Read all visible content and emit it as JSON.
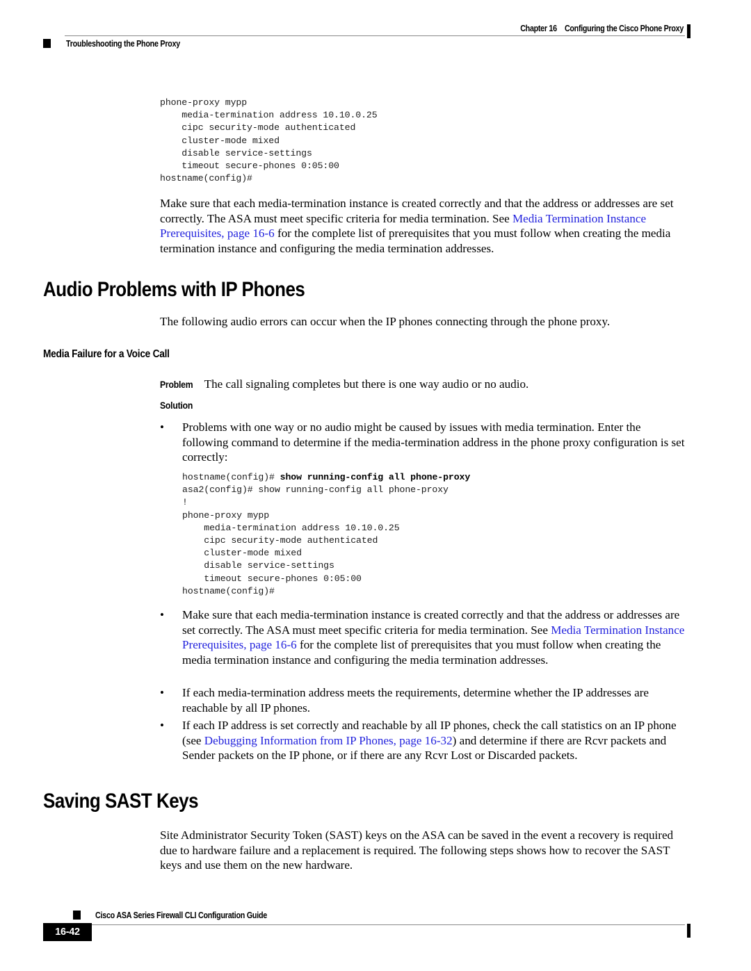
{
  "header": {
    "chapter_number": "Chapter 16",
    "chapter_title": "Configuring the Cisco Phone Proxy",
    "running_head": "Troubleshooting the Phone Proxy"
  },
  "body": {
    "cli_block_1": "phone-proxy mypp\n    media-termination address 10.10.0.25\n    cipc security-mode authenticated\n    cluster-mode mixed\n    disable service-settings\n    timeout secure-phones 0:05:00\nhostname(config)#",
    "paragraph_1_part1": "Make sure that each media-termination instance is created correctly and that the address or addresses are set correctly. The ASA must meet specific criteria for media termination. See ",
    "paragraph_1_link": "Media Termination Instance Prerequisites, page 16-6",
    "paragraph_1_part2": " for the complete list of prerequisites that you must follow when creating the media termination instance and configuring the media termination addresses.",
    "heading_audio_problems": "Audio Problems with IP Phones",
    "paragraph_2": "The following audio errors can occur when the IP phones connecting through the phone proxy.",
    "heading_media_failure": "Media Failure for a Voice Call",
    "problem_label": "Problem",
    "problem_text": "The call signaling completes but there is one way audio or no audio.",
    "solution_label": "Solution",
    "bullet_1": "Problems with one way or no audio might be caused by issues with media termination. Enter the following command to determine if the media-termination address in the phone proxy configuration is set correctly:",
    "cli_block_2_prompt": "hostname(config)# ",
    "cli_block_2_command": "show running-config all phone-proxy",
    "cli_block_2_rest": "asa2(config)# show running-config all phone-proxy\n!\nphone-proxy mypp\n    media-termination address 10.10.0.25\n    cipc security-mode authenticated\n    cluster-mode mixed\n    disable service-settings\n    timeout secure-phones 0:05:00\nhostname(config)#",
    "bullet_2_part1": "Make sure that each media-termination instance is created correctly and that the address or addresses are set correctly. The ASA must meet specific criteria for media termination. See ",
    "bullet_2_link": "Media Termination Instance Prerequisites, page 16-6",
    "bullet_2_part2": " for the complete list of prerequisites that you must follow when creating the media termination instance and configuring the media termination addresses.",
    "bullet_3": "If each media-termination address meets the requirements, determine whether the IP addresses are reachable by all IP phones.",
    "bullet_4_part1": "If each IP address is set correctly and reachable by all IP phones, check the call statistics on an IP phone (see ",
    "bullet_4_link": "Debugging Information from IP Phones, page 16-32",
    "bullet_4_part2": ") and determine if there are Rcvr packets and Sender packets on the IP phone, or if there are any Rcvr Lost or Discarded packets.",
    "heading_saving_sast": "Saving SAST Keys",
    "paragraph_3": "Site Administrator Security Token (SAST) keys on the ASA can be saved in the event a recovery is required due to hardware failure and a replacement is required. The following steps shows how to recover the SAST keys and use them on the new hardware.",
    "bullet_marker": "•"
  },
  "footer": {
    "guide_title": "Cisco ASA Series Firewall CLI Configuration Guide",
    "page_number": "16-42"
  },
  "colors": {
    "link": "#2222dd",
    "rule": "#8a8a8a",
    "text": "#000000"
  }
}
